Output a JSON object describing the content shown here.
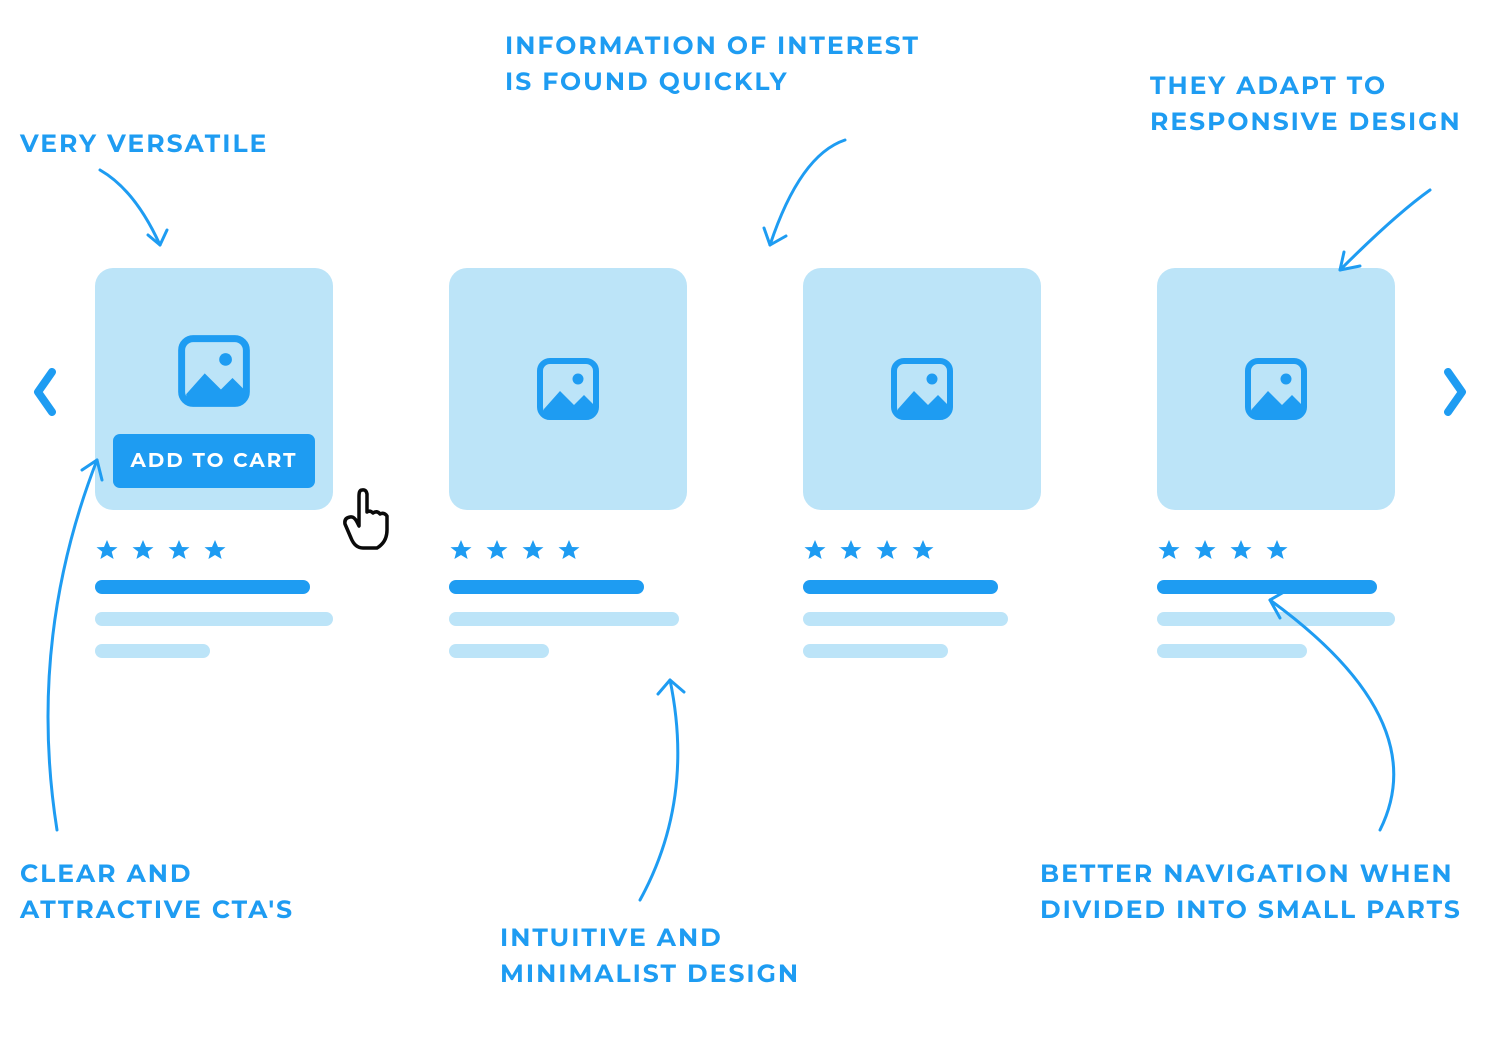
{
  "colors": {
    "accent": "#1E9CF2",
    "light": "#BCE4F8",
    "white": "#FFFFFF",
    "cursor": "#0A0A0A"
  },
  "annotations": {
    "versatile": "VERY VERSATILE",
    "info_found": "INFORMATION OF INTEREST IS FOUND QUICKLY",
    "responsive": "THEY ADAPT TO RESPONSIVE DESIGN",
    "clear_cta": "CLEAR AND ATTRACTIVE CTA'S",
    "intuitive": "INTUITIVE AND MINIMALIST DESIGN",
    "navigation": "BETTER NAVIGATION WHEN DIVIDED INTO SMALL PARTS"
  },
  "cta_label": "ADD TO CART",
  "cards": {
    "count": 4,
    "stars_per_card": 4,
    "first_has_cta": true,
    "title_bar_widths": [
      215,
      195,
      195,
      220
    ],
    "line1_widths": [
      238,
      230,
      205,
      238
    ],
    "line2_widths": [
      115,
      100,
      145,
      150
    ]
  },
  "carousel": {
    "has_prev": true,
    "has_next": true
  }
}
